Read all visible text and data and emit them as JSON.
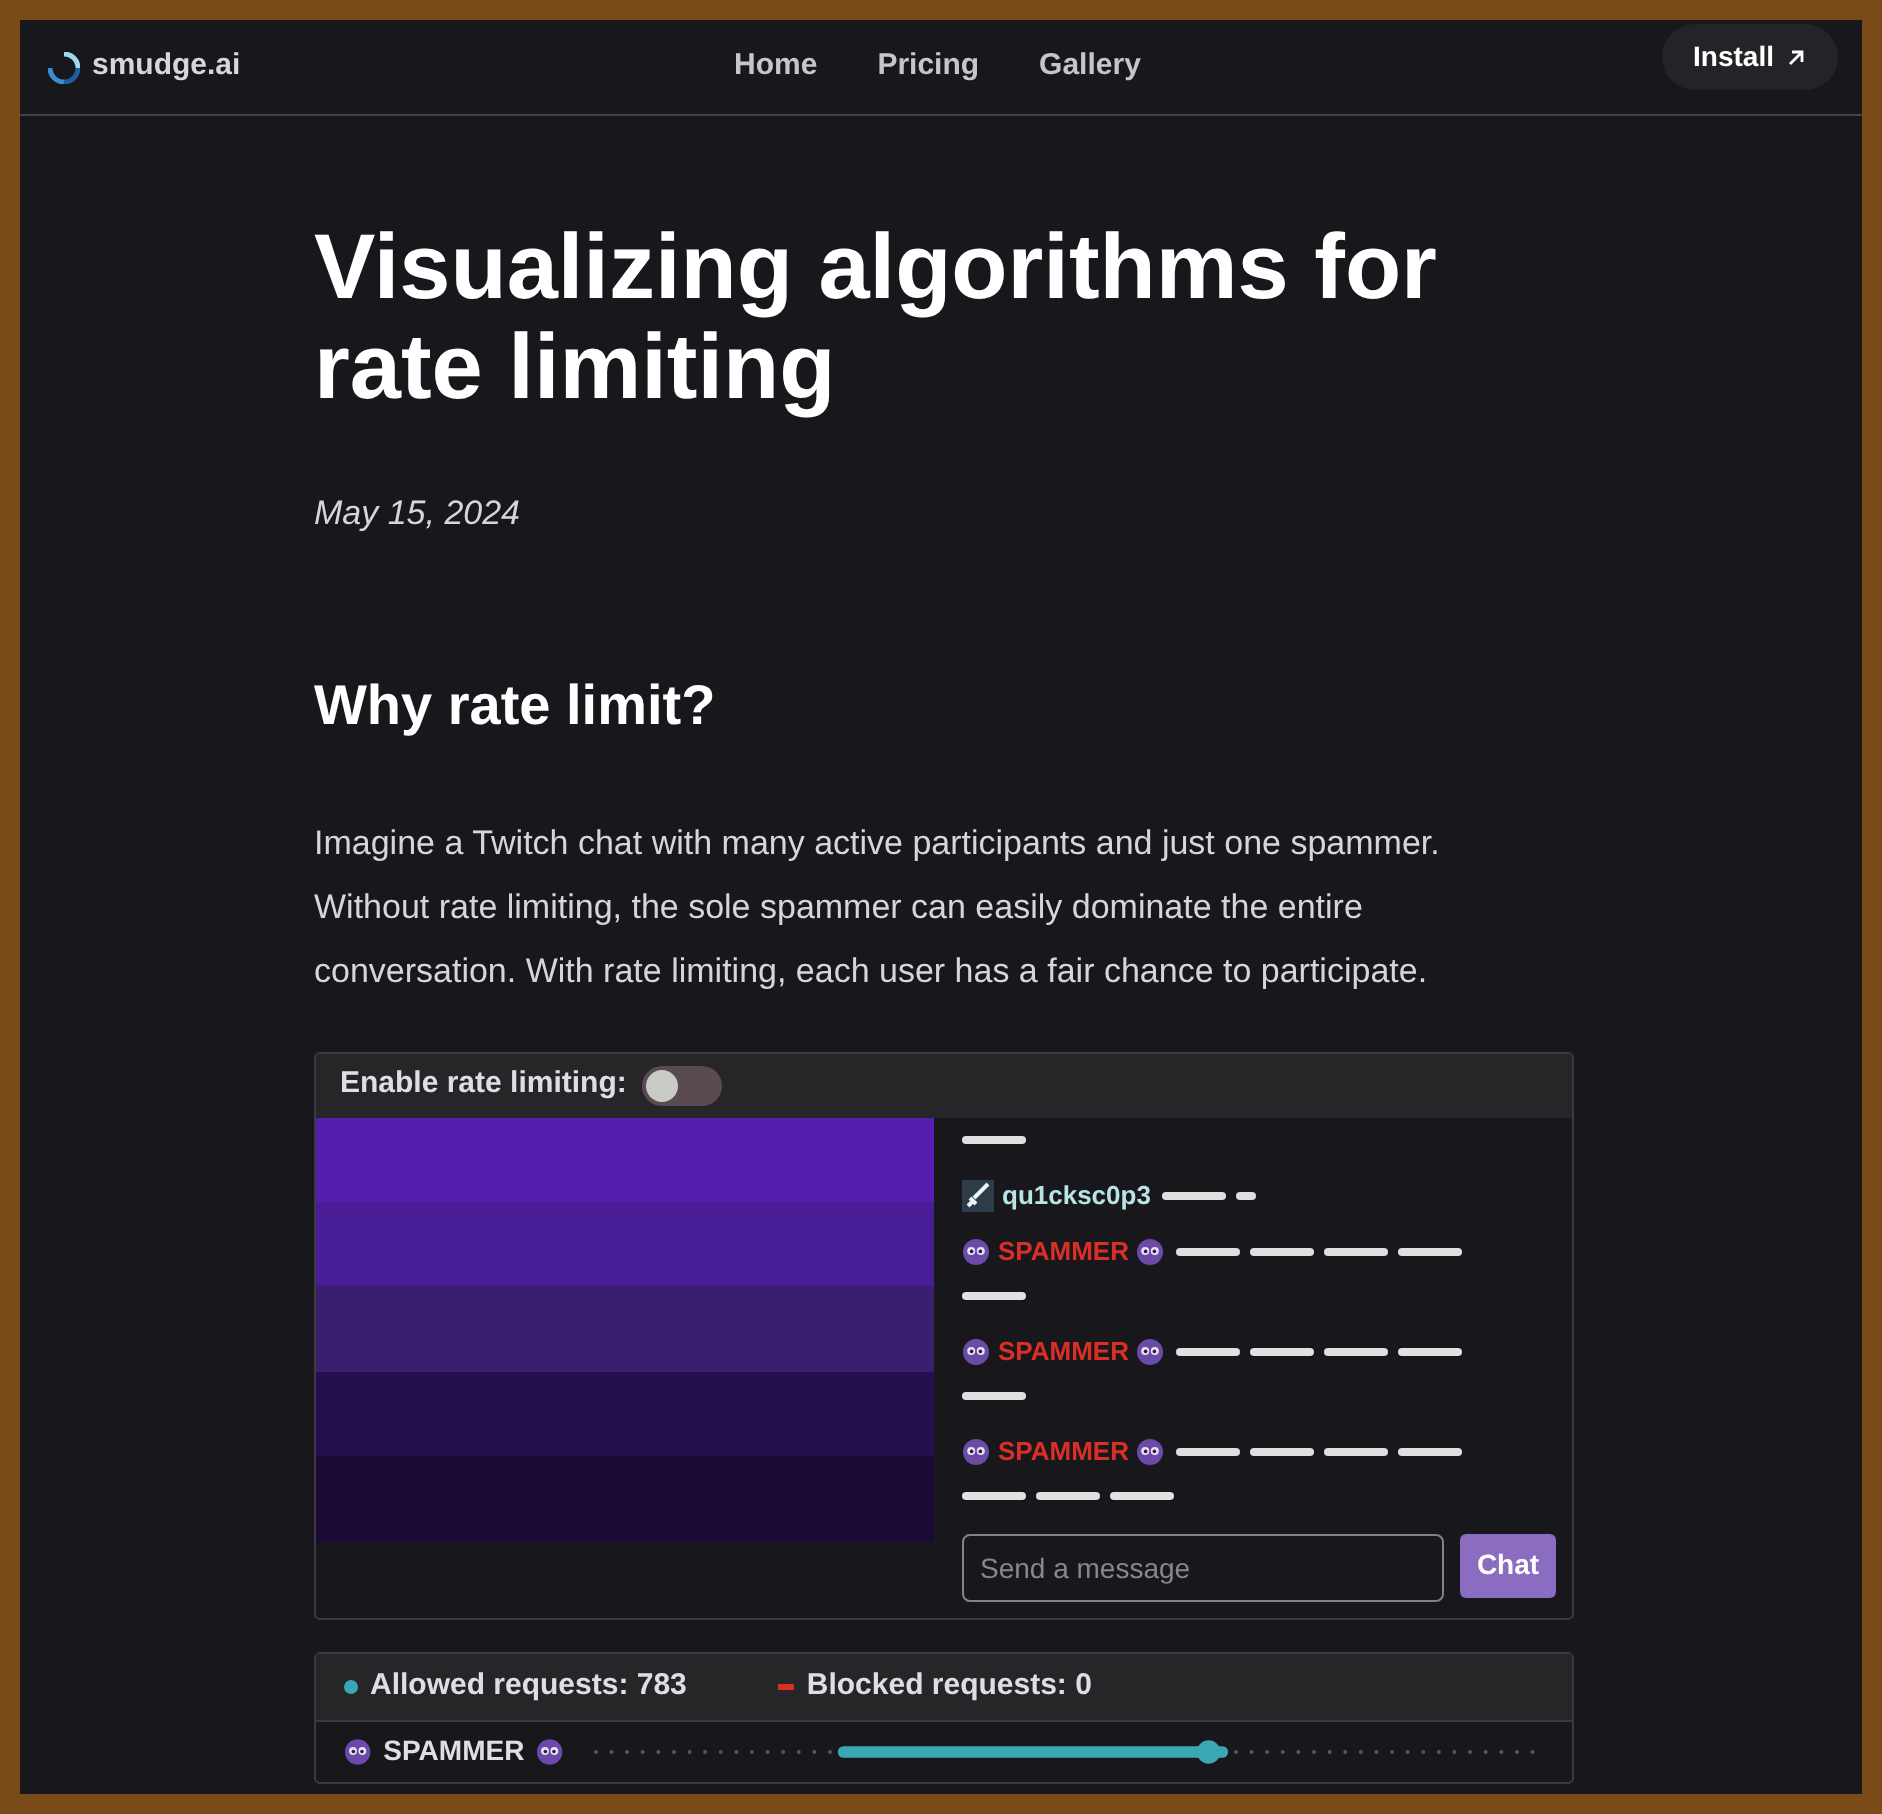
{
  "nav": {
    "brand": "smudge.ai",
    "links": [
      {
        "label": "Home"
      },
      {
        "label": "Pricing"
      },
      {
        "label": "Gallery"
      }
    ],
    "install": "Install"
  },
  "article": {
    "title": "Visualizing algorithms for rate limiting",
    "date": "May 15, 2024",
    "heading": "Why rate limit?",
    "paragraph": "Imagine a Twitch chat with many active participants and just one spammer. Without rate limiting, the sole spammer can easily dominate the entire conversation. With rate limiting, each user has a fair chance to participate."
  },
  "demo": {
    "toggle_label": "Enable rate limiting:",
    "enabled": false,
    "messages": [
      {
        "kind": "continuation"
      },
      {
        "kind": "user",
        "name": "qu1cksc0p3",
        "color": "#b9e4e4"
      },
      {
        "kind": "spammer",
        "name": "SPAMMER",
        "color": "#d93025"
      },
      {
        "kind": "spammer",
        "name": "SPAMMER",
        "color": "#d93025"
      },
      {
        "kind": "spammer",
        "name": "SPAMMER",
        "color": "#d93025"
      }
    ],
    "input": {
      "placeholder": "Send a message"
    },
    "send": "Chat"
  },
  "stats": {
    "legend": [
      {
        "label": "Allowed requests: 783",
        "color": "#3aa8b4"
      },
      {
        "label": "Blocked requests: 0",
        "color": "#d93025"
      }
    ],
    "rows": [
      {
        "name": "SPAMMER"
      }
    ]
  }
}
